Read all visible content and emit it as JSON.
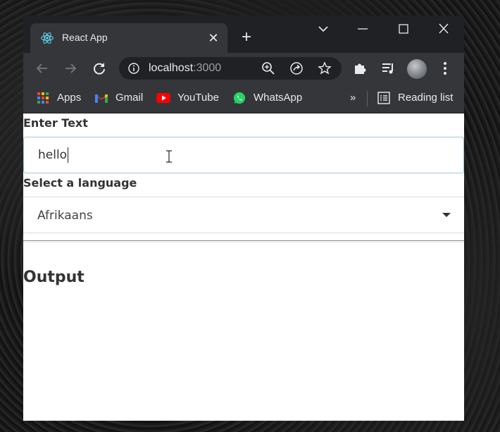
{
  "browser": {
    "tab": {
      "title": "React App",
      "favicon": "react-logo-icon"
    },
    "address_bar": {
      "host": "localhost",
      "port": ":3000"
    },
    "bookmarks": [
      {
        "label": "Apps",
        "icon": "apps-grid-icon"
      },
      {
        "label": "Gmail",
        "icon": "gmail-icon"
      },
      {
        "label": "YouTube",
        "icon": "youtube-icon"
      },
      {
        "label": "WhatsApp",
        "icon": "whatsapp-icon"
      }
    ],
    "reading_list_label": "Reading list",
    "more_bookmarks_glyph": "»"
  },
  "page": {
    "text_label": "Enter Text",
    "text_value": "hello",
    "language_label": "Select a language",
    "language_selected": "Afrikaans",
    "output_heading": "Output"
  },
  "colors": {
    "chrome_dark": "#202124",
    "chrome_toolbar": "#35363a",
    "input_focus_border": "#9fc9d5",
    "text": "#333333"
  }
}
